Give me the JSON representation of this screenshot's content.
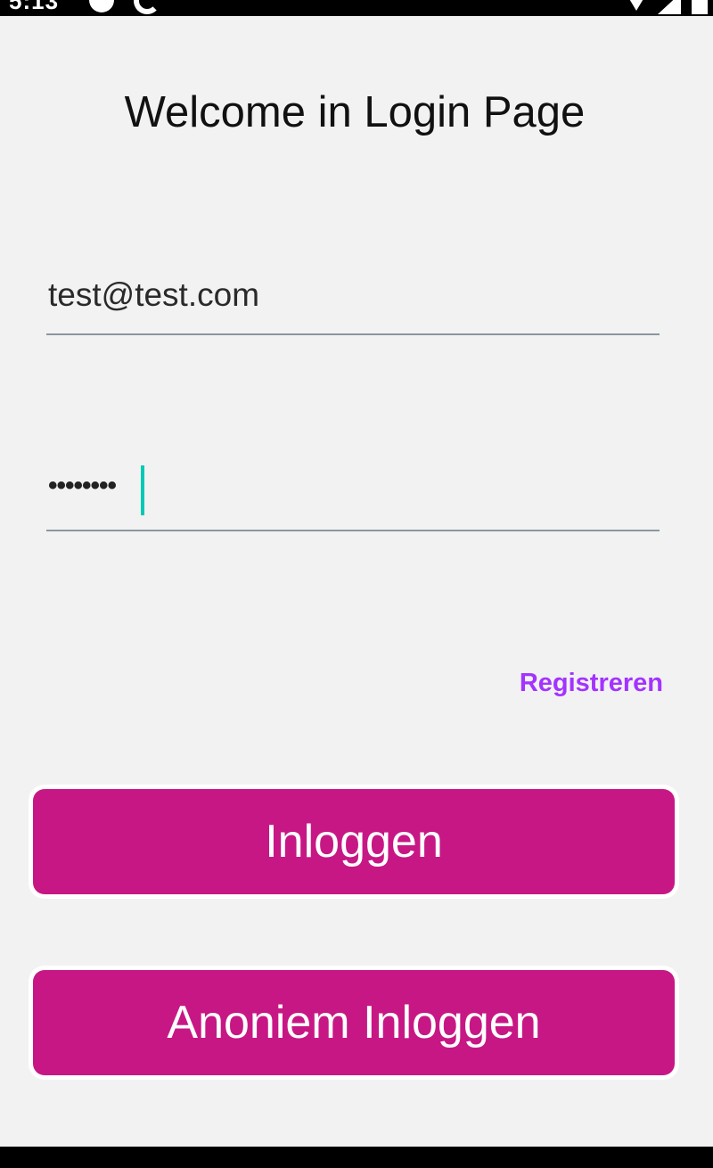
{
  "status_bar": {
    "time": "5:13"
  },
  "page": {
    "title": "Welcome in Login Page"
  },
  "email": {
    "value": "test@test.com"
  },
  "password": {
    "masked_value": "••••••••"
  },
  "links": {
    "register": "Registreren"
  },
  "buttons": {
    "login": "Inloggen",
    "anonymous_login": "Anoniem Inloggen"
  },
  "colors": {
    "button": "#c71785",
    "link": "#a333ff",
    "caret": "#00c9b5",
    "background": "#f2f2f2"
  }
}
